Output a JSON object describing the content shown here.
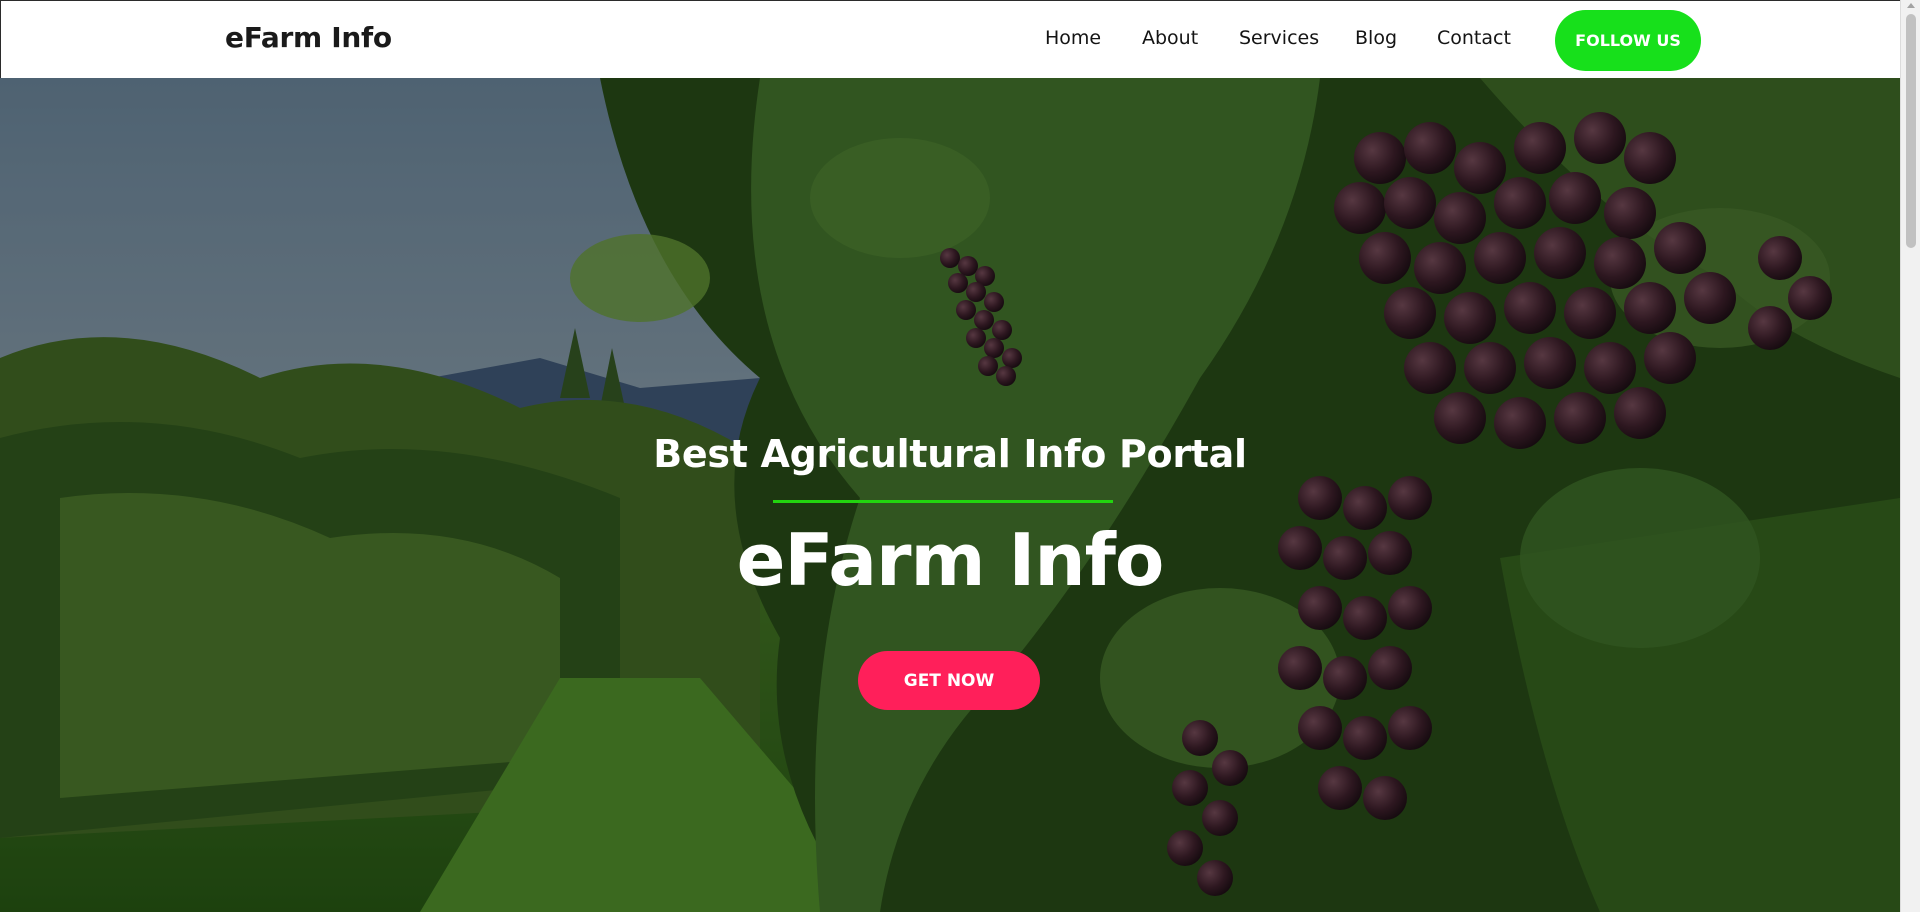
{
  "navbar": {
    "brand": "eFarm Info",
    "links": [
      "Home",
      "About",
      "Services",
      "Blog",
      "Contact"
    ],
    "follow_label": "FOLLOW US",
    "follow_color": "#17e01b"
  },
  "hero": {
    "subtitle": "Best Agricultural Info Portal",
    "title": "eFarm Info",
    "cta_label": "GET NOW",
    "cta_color": "#ff1f5a",
    "divider_color": "#22d40f",
    "background": "vineyard-grapes-image"
  }
}
